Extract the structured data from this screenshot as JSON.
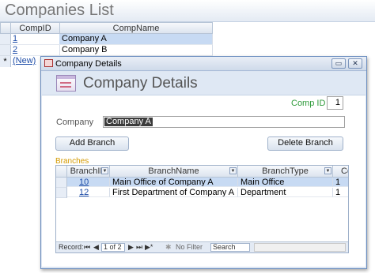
{
  "companies_list": {
    "title": "Companies List",
    "columns": [
      "CompID",
      "CompName"
    ],
    "rows": [
      {
        "id": "1",
        "name": "Company A"
      },
      {
        "id": "2",
        "name": "Company B"
      }
    ],
    "new_row_marker": "*",
    "new_row_label": "(New)"
  },
  "details_window": {
    "title": "Company Details",
    "header_title": "Company Details",
    "comp_id_label": "Comp ID",
    "comp_id_value": "1",
    "company_label": "Company",
    "company_value": "Company A",
    "add_branch_label": "Add Branch",
    "delete_branch_label": "Delete Branch",
    "branches_label": "Branches",
    "branches": {
      "columns": [
        "BranchID",
        "BranchName",
        "BranchType",
        "Comp"
      ],
      "rows": [
        {
          "id": "10",
          "name": "Main Office of Company A",
          "type": "Main Office",
          "comp": "1"
        },
        {
          "id": "12",
          "name": "First Department of Company A",
          "type": "Department",
          "comp": "1"
        }
      ]
    },
    "record_nav": {
      "label": "Record:",
      "position": "1 of 2",
      "filter_label": "No Filter",
      "search_placeholder": "Search"
    }
  },
  "colors": {
    "accent_green": "#2e9a3a",
    "branches_label": "#d49a00",
    "link": "#1f4ea8",
    "selected_row": "#c7daf3"
  }
}
